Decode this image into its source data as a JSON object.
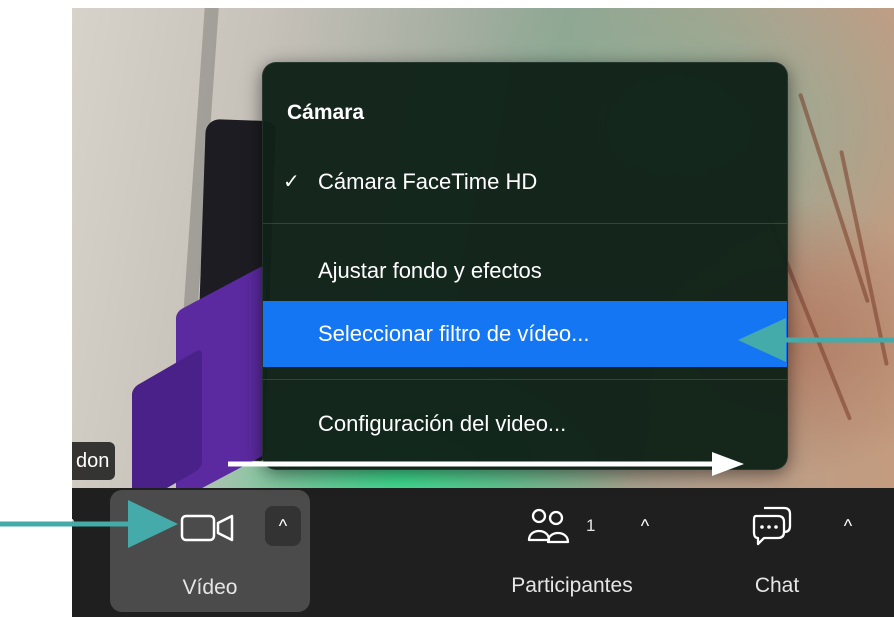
{
  "menu": {
    "header": "Cámara",
    "items": [
      {
        "label": "Cámara FaceTime HD",
        "checked": true
      },
      {
        "label": "Ajustar fondo y efectos",
        "checked": false
      },
      {
        "label": "Seleccionar filtro de vídeo...",
        "checked": false,
        "selected": true
      },
      {
        "label": "Configuración del video...",
        "checked": false
      }
    ],
    "check_glyph": "✓"
  },
  "participant_name": "don",
  "toolbar": {
    "video_label": "Vídeo",
    "participants_label": "Participantes",
    "participants_count": "1",
    "chat_label": "Chat",
    "caret_glyph": "^"
  },
  "colors": {
    "accent_selected": "#1476f2",
    "annotation_arrow": "#45aaaa",
    "toolbar_bg": "#1f1f1f"
  },
  "icons": [
    "video-camera-icon",
    "participants-icon",
    "chat-icon",
    "caret-up-icon",
    "checkmark-icon",
    "annotation-arrow-icon"
  ]
}
